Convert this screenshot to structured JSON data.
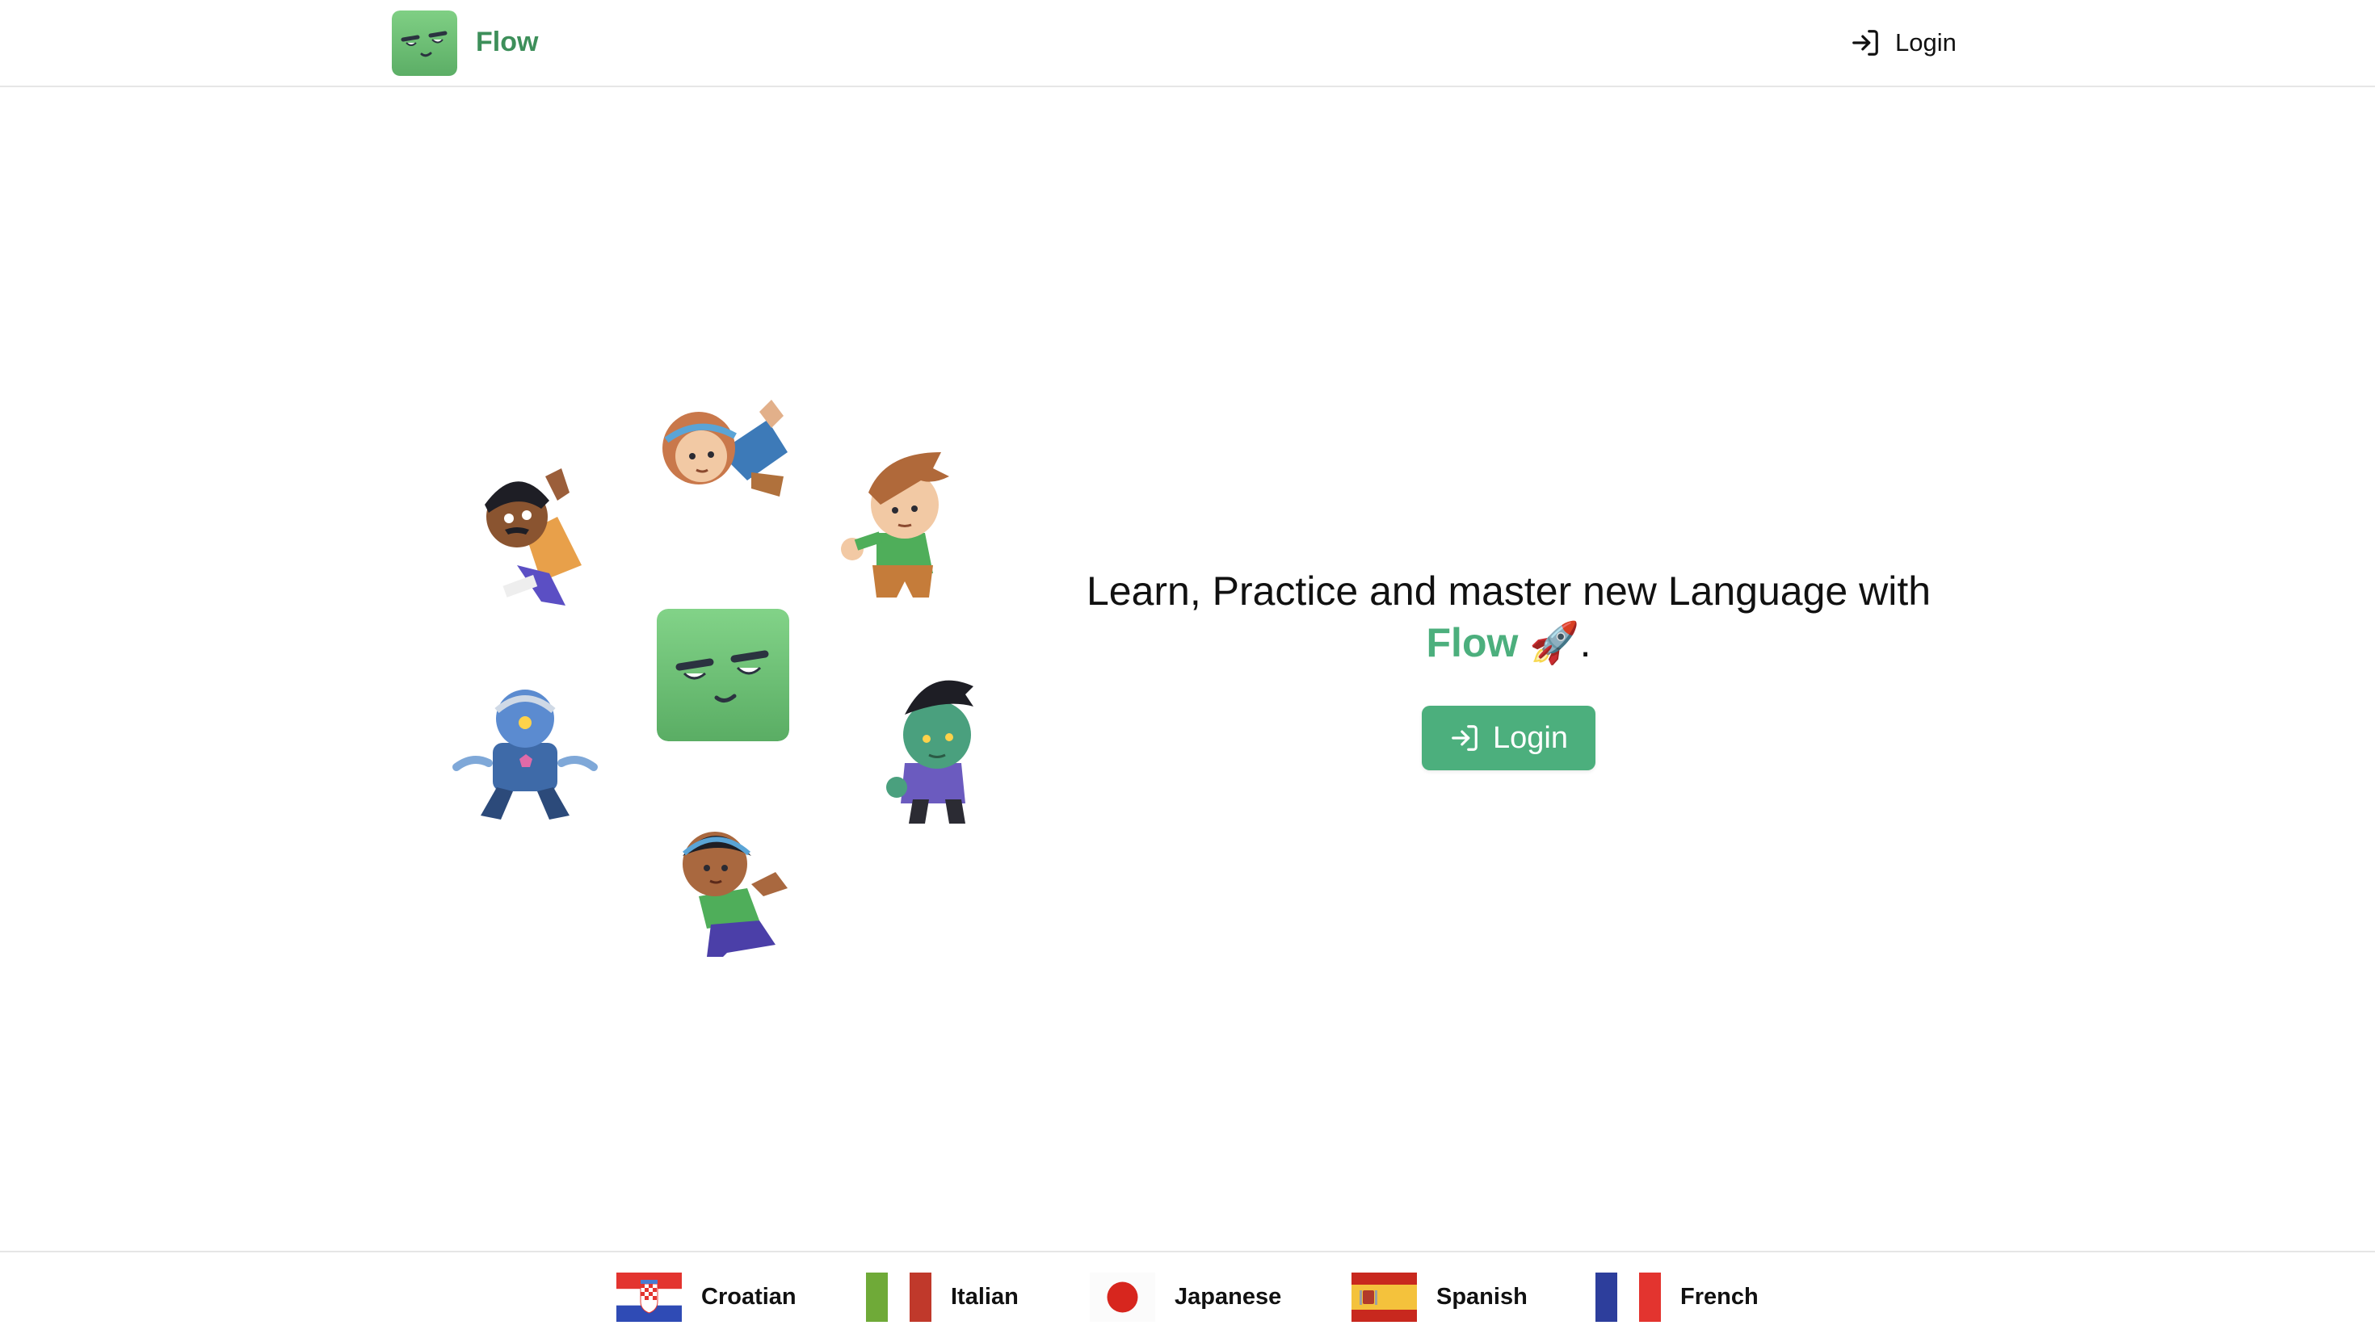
{
  "header": {
    "brand": "Flow",
    "login_label": "Login"
  },
  "hero": {
    "headline_line1": "Learn, Practice and master new Language with",
    "headline_flow": "Flow",
    "headline_rocket": "🚀",
    "headline_end": ".",
    "button_label": "Login"
  },
  "languages": [
    {
      "name": "Croatian",
      "flag": "croatia-flag"
    },
    {
      "name": "Italian",
      "flag": "italy-flag"
    },
    {
      "name": "Japanese",
      "flag": "japan-flag"
    },
    {
      "name": "Spanish",
      "flag": "spain-flag"
    },
    {
      "name": "French",
      "flag": "france-flag"
    }
  ],
  "colors": {
    "brand_green": "#4caf7d",
    "brand_text_green": "#3d8f5a"
  }
}
